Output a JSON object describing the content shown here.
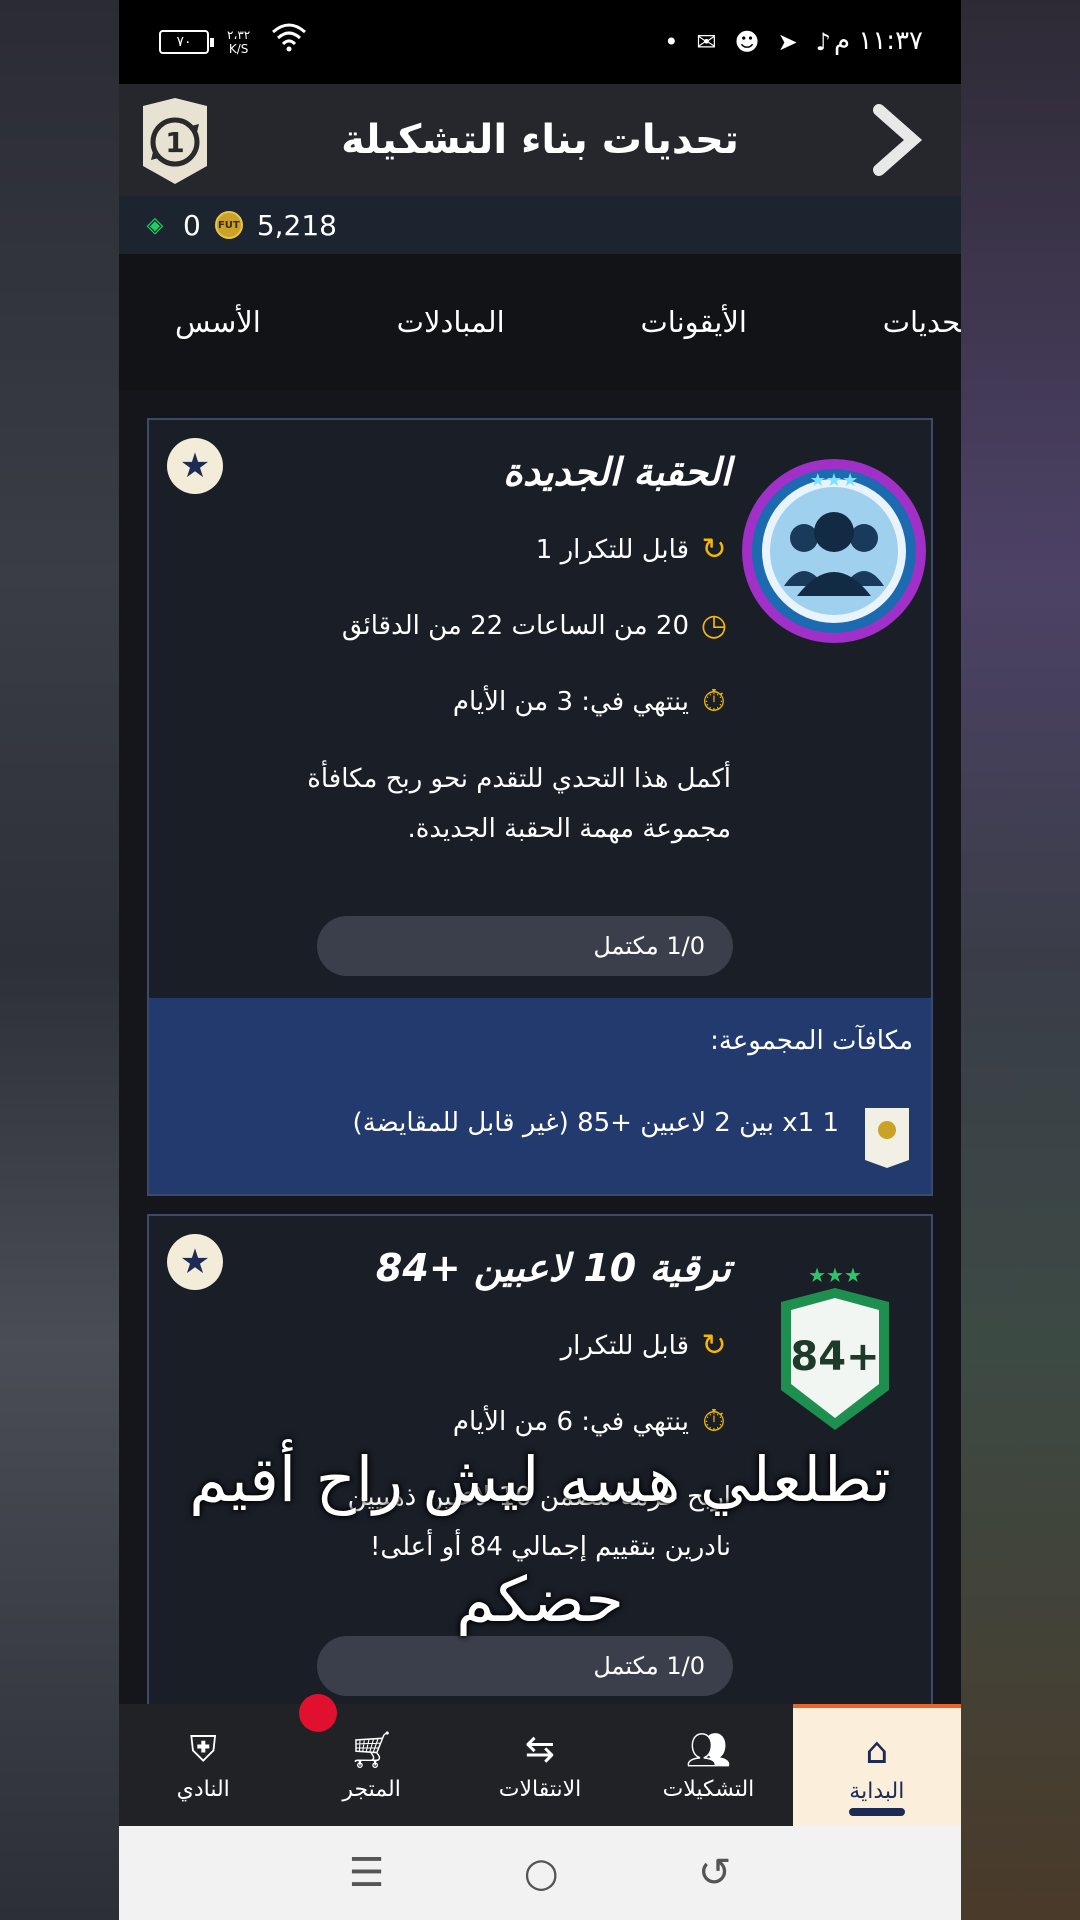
{
  "status_bar": {
    "time": "١١:٣٧ م",
    "battery": "٧٠",
    "speed_value": "٢،٣٢",
    "speed_unit": "K/S"
  },
  "header": {
    "title": "تحديات بناء التشكيلة"
  },
  "currency": {
    "points": "0",
    "coins": "5,218",
    "coin_label": "FUT"
  },
  "tabs": [
    "الأسس",
    "المبادلات",
    "الأيقونات",
    "تحديات"
  ],
  "cards": [
    {
      "title": "الحقبة الجديدة",
      "repeatable": "قابل للتكرار 1",
      "refresh": "20 من الساعات 22 من الدقائق",
      "expires": "ينتهي في: 3 من الأيام",
      "description": "أكمل هذا التحدي للتقدم نحو ربح مكافأة مجموعة مهمة الحقبة الجديدة.",
      "progress": "1/0 مكتمل",
      "group_rewards_label": "مكافآت المجموعة:",
      "reward_text": "1 x1 بين 2 لاعبين +85 (غير قابل للمقايضة)"
    },
    {
      "title": "ترقية 10 لاعبين +84",
      "repeatable": "قابل للتكرار",
      "expires": "ينتهي في: 6 من الأيام",
      "description": "اربح حزمة تتضمن 10 لاعبين ذهبيين نادرين بتقييم إجمالي 84 أو أعلى!",
      "progress": "1/0 مكتمل",
      "badge_text": "84+"
    }
  ],
  "overlay_caption": "تطلعلي هسه ليش راح أقيم حضكم",
  "bottom_nav": [
    {
      "label": "النادي",
      "icon": "club-icon"
    },
    {
      "label": "المتجر",
      "icon": "store-icon"
    },
    {
      "label": "الانتقالات",
      "icon": "transfers-icon"
    },
    {
      "label": "التشكيلات",
      "icon": "squads-icon"
    },
    {
      "label": "البداية",
      "icon": "home-icon"
    }
  ],
  "colors": {
    "accent_gold": "#f5b700",
    "nav_active_bg": "#fbefdc",
    "nav_active_bar": "#e8662a",
    "rewards_bg": "#223a6e",
    "notification": "#e0102e"
  }
}
